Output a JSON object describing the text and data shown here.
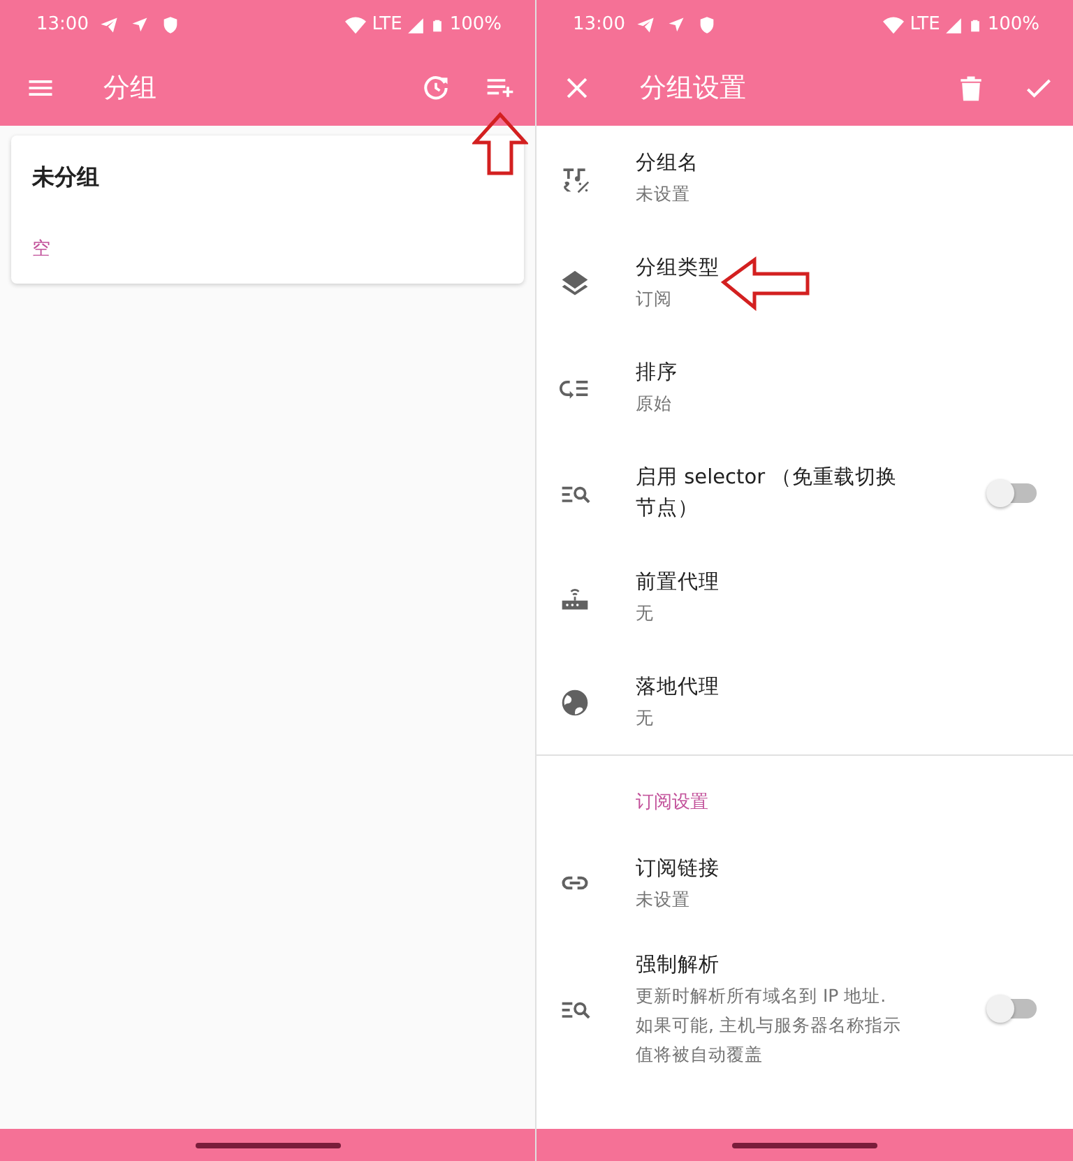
{
  "panes": [
    {
      "status_bar": {
        "time": "13:00",
        "network": "LTE",
        "battery": "100%"
      },
      "app_bar": {
        "title": "分组"
      },
      "groups": [
        {
          "name": "未分组",
          "status": "空"
        }
      ]
    },
    {
      "status_bar": {
        "time": "13:00",
        "network": "LTE",
        "battery": "100%"
      },
      "app_bar": {
        "title": "分组设置"
      },
      "settings": [
        {
          "kind": "item",
          "title": "分组名",
          "summary": "未设置"
        },
        {
          "kind": "item",
          "title": "分组类型",
          "summary": "订阅"
        },
        {
          "kind": "item",
          "title": "排序",
          "summary": "原始"
        },
        {
          "kind": "switch",
          "title": "启用 selector （免重载切换节点）",
          "on": false
        },
        {
          "kind": "item",
          "title": "前置代理",
          "summary": "无"
        },
        {
          "kind": "item",
          "title": "落地代理",
          "summary": "无"
        },
        {
          "kind": "header",
          "title": "订阅设置"
        },
        {
          "kind": "item",
          "title": "订阅链接",
          "summary": "未设置"
        },
        {
          "kind": "switch",
          "title": "强制解析",
          "summary": "更新时解析所有域名到 IP 地址. 如果可能, 主机与服务器名称指示值将被自动覆盖",
          "on": false
        }
      ]
    }
  ]
}
